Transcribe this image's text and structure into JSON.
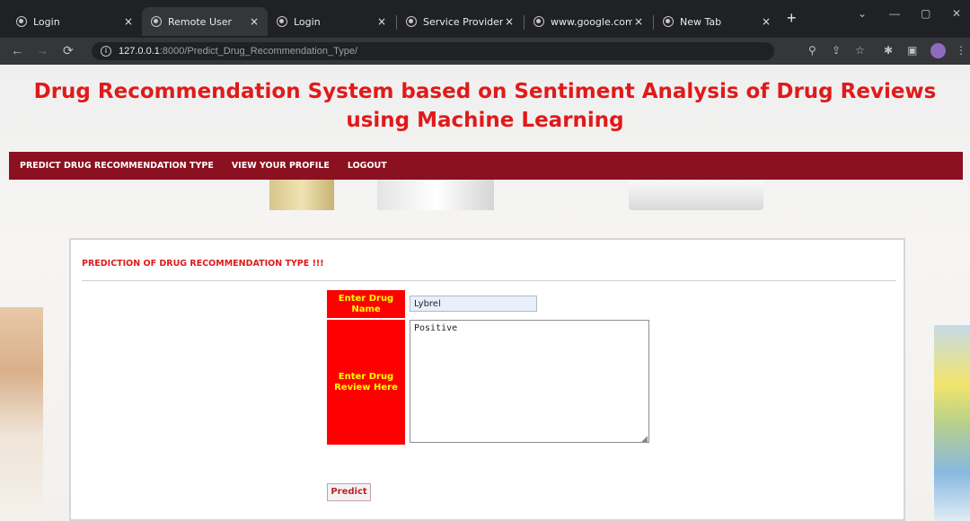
{
  "browser": {
    "tabs": [
      {
        "label": "Login",
        "active": false
      },
      {
        "label": "Remote User",
        "active": true
      },
      {
        "label": "Login",
        "active": false
      },
      {
        "label": "Service Provider",
        "active": false
      },
      {
        "label": "www.google.com",
        "active": false
      },
      {
        "label": "New Tab",
        "active": false
      }
    ],
    "tab_close_glyph": "×",
    "new_tab_glyph": "+",
    "url_host": "127.0.0.1",
    "url_path": ":8000/Predict_Drug_Recommendation_Type/",
    "window_controls": [
      "⌄",
      "—",
      "▢",
      "✕"
    ]
  },
  "page": {
    "title": "Drug Recommendation System based on Sentiment Analysis of Drug Reviews using Machine Learning",
    "nav": [
      {
        "label": "PREDICT DRUG RECOMMENDATION TYPE"
      },
      {
        "label": "VIEW YOUR PROFILE"
      },
      {
        "label": "LOGOUT"
      }
    ],
    "form": {
      "heading": "PREDICTION OF DRUG RECOMMENDATION TYPE !!!",
      "drug_name_label": "Enter Drug Name",
      "drug_name_value": "Lybrel",
      "review_label": "Enter Drug Review Here",
      "review_value": "Positive",
      "submit_label": "Predict"
    }
  },
  "colors": {
    "title_red": "#e01a1a",
    "nav_bg": "#8b1020",
    "label_bg": "#ff0000",
    "label_text": "#ffff00"
  }
}
